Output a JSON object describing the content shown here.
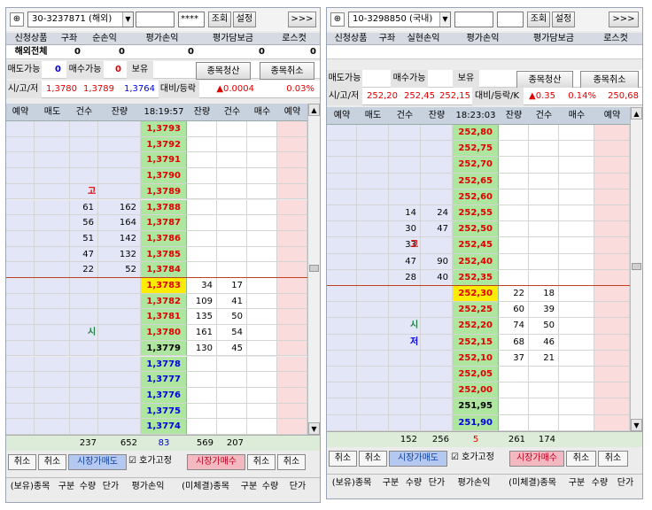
{
  "left": {
    "account": "30-3237871 (해외)",
    "password_mask": "****",
    "query_label": "조회",
    "settings_label": "설정",
    "more_label": ">>>",
    "header_labels": [
      "신청상품",
      "구좌",
      "순손익",
      "평가손익",
      "평가담보금",
      "로스컷"
    ],
    "header_values": [
      "해외전체",
      "0",
      "0",
      "0",
      "0",
      "0"
    ],
    "sell_avail_label": "매도가능",
    "sell_avail_value": "0",
    "buy_avail_label": "매수가능",
    "buy_avail_value": "0",
    "hold_label": "보유",
    "close_label": "종목청산",
    "cancel_label": "종목취소",
    "ohl_label": "시/고/저",
    "open": "1,3780",
    "high": "1,3789",
    "low": "1,3764",
    "change_label": "대비/등락",
    "change": "▲0.0004",
    "change_pct": "0.03%",
    "book_headers": [
      "예약",
      "매도",
      "건수",
      "잔량",
      "18:19:57",
      "잔량",
      "건수",
      "매수",
      "예약"
    ],
    "rows": [
      {
        "ac": "",
        "aq": "",
        "p": "1,3793",
        "bq": "",
        "bc": "",
        "m": "",
        "pc": "red"
      },
      {
        "ac": "",
        "aq": "",
        "p": "1,3792",
        "bq": "",
        "bc": "",
        "m": "",
        "pc": "red"
      },
      {
        "ac": "",
        "aq": "",
        "p": "1,3791",
        "bq": "",
        "bc": "",
        "m": "",
        "pc": "red"
      },
      {
        "ac": "",
        "aq": "",
        "p": "1,3790",
        "bq": "",
        "bc": "",
        "m": "",
        "pc": "red"
      },
      {
        "ac": "",
        "aq": "",
        "p": "1,3789",
        "bq": "",
        "bc": "",
        "m": "고",
        "pc": "red"
      },
      {
        "ac": "61",
        "aq": "162",
        "p": "1,3788",
        "bq": "",
        "bc": "",
        "m": "",
        "pc": "red"
      },
      {
        "ac": "56",
        "aq": "164",
        "p": "1,3787",
        "bq": "",
        "bc": "",
        "m": "",
        "pc": "red"
      },
      {
        "ac": "51",
        "aq": "142",
        "p": "1,3786",
        "bq": "",
        "bc": "",
        "m": "",
        "pc": "red"
      },
      {
        "ac": "47",
        "aq": "132",
        "p": "1,3785",
        "bq": "",
        "bc": "",
        "m": "",
        "pc": "red"
      },
      {
        "ac": "22",
        "aq": "52",
        "p": "1,3784",
        "bq": "",
        "bc": "",
        "m": "",
        "pc": "red"
      },
      {
        "ac": "",
        "aq": "",
        "p": "1,3783",
        "bq": "34",
        "bc": "17",
        "m": "",
        "pc": "red",
        "cur": true
      },
      {
        "ac": "",
        "aq": "",
        "p": "1,3782",
        "bq": "109",
        "bc": "41",
        "m": "",
        "pc": "red"
      },
      {
        "ac": "",
        "aq": "",
        "p": "1,3781",
        "bq": "135",
        "bc": "50",
        "m": "",
        "pc": "red"
      },
      {
        "ac": "",
        "aq": "",
        "p": "1,3780",
        "bq": "161",
        "bc": "54",
        "m": "시",
        "pc": "red"
      },
      {
        "ac": "",
        "aq": "",
        "p": "1,3779",
        "bq": "130",
        "bc": "45",
        "m": "",
        "pc": "black"
      },
      {
        "ac": "",
        "aq": "",
        "p": "1,3778",
        "bq": "",
        "bc": "",
        "m": "",
        "pc": "blue"
      },
      {
        "ac": "",
        "aq": "",
        "p": "1,3777",
        "bq": "",
        "bc": "",
        "m": "",
        "pc": "blue"
      },
      {
        "ac": "",
        "aq": "",
        "p": "1,3776",
        "bq": "",
        "bc": "",
        "m": "",
        "pc": "blue"
      },
      {
        "ac": "",
        "aq": "",
        "p": "1,3775",
        "bq": "",
        "bc": "",
        "m": "",
        "pc": "blue"
      },
      {
        "ac": "",
        "aq": "",
        "p": "1,3774",
        "bq": "",
        "bc": "",
        "m": "",
        "pc": "blue"
      }
    ],
    "totals": {
      "ask_count": "237",
      "ask_qty": "652",
      "net": "83",
      "bid_qty": "569",
      "bid_count": "207"
    },
    "actions": {
      "cancel1": "취소",
      "cancel2": "취소",
      "market_sell": "시장가매도",
      "fix": "호가고정",
      "market_buy": "시장가매수",
      "cancel3": "취소",
      "cancel4": "취소"
    },
    "footer": [
      "(보유)종목",
      "구분",
      "수량",
      "단가",
      "평가손익",
      "(미체결)종목",
      "구분",
      "수량",
      "단가"
    ]
  },
  "right": {
    "account": "10-3298850 (국내)",
    "query_label": "조회",
    "settings_label": "설정",
    "more_label": ">>>",
    "header_labels": [
      "신청상품",
      "구좌",
      "실현손익",
      "평가손익",
      "평가담보금",
      "로스컷"
    ],
    "sell_avail_label": "매도가능",
    "buy_avail_label": "매수가능",
    "hold_label": "보유",
    "close_label": "종목청산",
    "cancel_label": "종목취소",
    "ohl_label": "시/고/저",
    "open": "252,20",
    "high": "252,45",
    "low": "252,15",
    "change_label": "대비/등락/K",
    "change": "▲0.35",
    "change_pct": "0.14%",
    "k_value": "250,68",
    "book_headers": [
      "예약",
      "매도",
      "건수",
      "잔량",
      "18:23:03",
      "잔량",
      "건수",
      "매수",
      "예약"
    ],
    "rows": [
      {
        "ac": "",
        "aq": "",
        "p": "252,80",
        "bq": "",
        "bc": "",
        "m": "",
        "pc": "red"
      },
      {
        "ac": "",
        "aq": "",
        "p": "252,75",
        "bq": "",
        "bc": "",
        "m": "",
        "pc": "red"
      },
      {
        "ac": "",
        "aq": "",
        "p": "252,70",
        "bq": "",
        "bc": "",
        "m": "",
        "pc": "red"
      },
      {
        "ac": "",
        "aq": "",
        "p": "252,65",
        "bq": "",
        "bc": "",
        "m": "",
        "pc": "red"
      },
      {
        "ac": "",
        "aq": "",
        "p": "252,60",
        "bq": "",
        "bc": "",
        "m": "",
        "pc": "red"
      },
      {
        "ac": "14",
        "aq": "24",
        "p": "252,55",
        "bq": "",
        "bc": "",
        "m": "",
        "pc": "red"
      },
      {
        "ac": "30",
        "aq": "47",
        "p": "252,50",
        "bq": "",
        "bc": "",
        "m": "",
        "pc": "red"
      },
      {
        "ac": "33",
        "aq": "55",
        "p": "252,45",
        "bq": "",
        "bc": "",
        "m": "고",
        "pc": "red"
      },
      {
        "ac": "47",
        "aq": "90",
        "p": "252,40",
        "bq": "",
        "bc": "",
        "m": "",
        "pc": "red"
      },
      {
        "ac": "28",
        "aq": "40",
        "p": "252,35",
        "bq": "",
        "bc": "",
        "m": "",
        "pc": "red"
      },
      {
        "ac": "",
        "aq": "",
        "p": "252,30",
        "bq": "22",
        "bc": "18",
        "m": "",
        "pc": "red",
        "cur": true
      },
      {
        "ac": "",
        "aq": "",
        "p": "252,25",
        "bq": "60",
        "bc": "39",
        "m": "",
        "pc": "red"
      },
      {
        "ac": "",
        "aq": "",
        "p": "252,20",
        "bq": "74",
        "bc": "50",
        "m": "시",
        "pc": "red"
      },
      {
        "ac": "",
        "aq": "",
        "p": "252,15",
        "bq": "68",
        "bc": "46",
        "m": "저",
        "pc": "red"
      },
      {
        "ac": "",
        "aq": "",
        "p": "252,10",
        "bq": "37",
        "bc": "21",
        "m": "",
        "pc": "red"
      },
      {
        "ac": "",
        "aq": "",
        "p": "252,05",
        "bq": "",
        "bc": "",
        "m": "",
        "pc": "red"
      },
      {
        "ac": "",
        "aq": "",
        "p": "252,00",
        "bq": "",
        "bc": "",
        "m": "",
        "pc": "red"
      },
      {
        "ac": "",
        "aq": "",
        "p": "251,95",
        "bq": "",
        "bc": "",
        "m": "",
        "pc": "black"
      },
      {
        "ac": "",
        "aq": "",
        "p": "251,90",
        "bq": "",
        "bc": "",
        "m": "",
        "pc": "blue"
      }
    ],
    "totals": {
      "ask_count": "152",
      "ask_qty": "256",
      "net": "5",
      "bid_qty": "261",
      "bid_count": "174"
    },
    "actions": {
      "cancel1": "취소",
      "cancel2": "취소",
      "market_sell": "시장가매도",
      "fix": "호가고정",
      "market_buy": "시장가매수",
      "cancel3": "취소",
      "cancel4": "취소"
    },
    "footer": [
      "(보유)종목",
      "구분",
      "수량",
      "단가",
      "평가손익",
      "(미체결)종목",
      "구분",
      "수량",
      "단가"
    ]
  },
  "colors": {
    "red": "#e00000",
    "blue": "#0000e0",
    "black": "#000000",
    "ask_bg": "#e2e6f6",
    "bid_bg": "#fadcdc",
    "price_bg": "#aee6a0",
    "current_bg": "#ffec00",
    "market_sell_bg": "#b4c8f0",
    "market_buy_bg": "#f4b8c0"
  }
}
